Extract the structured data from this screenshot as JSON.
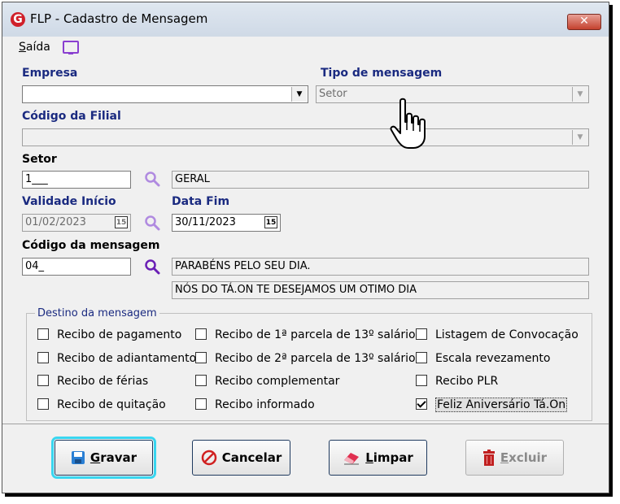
{
  "window": {
    "title": "FLP - Cadastro de Mensagem",
    "close_label": "✕"
  },
  "menu": {
    "saida_first": "S",
    "saida_rest": "aída"
  },
  "empresa": {
    "label": "Empresa",
    "value": ""
  },
  "tipo_mensagem": {
    "label": "Tipo de mensagem",
    "value": "Setor"
  },
  "codigo_filial": {
    "label": "Código da Filial",
    "value": ""
  },
  "setor": {
    "label": "Setor",
    "code": "1___",
    "description": "GERAL"
  },
  "validade_inicio": {
    "label": "Validade Início",
    "value": "01/02/2023"
  },
  "data_fim": {
    "label": "Data Fim",
    "value": "30/11/2023"
  },
  "calendar_icon_text": "15",
  "codigo_mensagem": {
    "label": "Código da mensagem",
    "code": "04_",
    "line1": "PARABÉNS PELO SEU DIA.",
    "line2": "NÓS DO TÁ.ON TE DESEJAMOS UM OTIMO DIA"
  },
  "destino": {
    "title": "Destino da mensagem",
    "items": [
      {
        "label": "Recibo de pagamento",
        "checked": false
      },
      {
        "label": "Recibo de adiantamento",
        "checked": false
      },
      {
        "label": "Recibo de férias",
        "checked": false
      },
      {
        "label": "Recibo de quitação",
        "checked": false
      },
      {
        "label": "Recibo de 1ª parcela de 13º salário",
        "checked": false
      },
      {
        "label": "Recibo de 2ª parcela de 13º salário",
        "checked": false
      },
      {
        "label": "Recibo complementar",
        "checked": false
      },
      {
        "label": "Recibo informado",
        "checked": false
      },
      {
        "label": "Listagem de Convocação",
        "checked": false
      },
      {
        "label": "Escala revezamento",
        "checked": false
      },
      {
        "label": "Recibo PLR",
        "checked": false
      },
      {
        "label": "Feliz Aniversário Tá.On",
        "checked": true
      }
    ]
  },
  "buttons": {
    "gravar": {
      "first": "G",
      "rest": "ravar"
    },
    "cancelar": {
      "label": "Cancelar"
    },
    "limpar": {
      "first": "L",
      "rest": "impar"
    },
    "excluir": {
      "first": "E",
      "rest": "xcluir"
    }
  },
  "colors": {
    "label_blue": "#1a2a80",
    "focus_cyan": "#38d6f0",
    "icon_purple": "#8a3fd0"
  }
}
